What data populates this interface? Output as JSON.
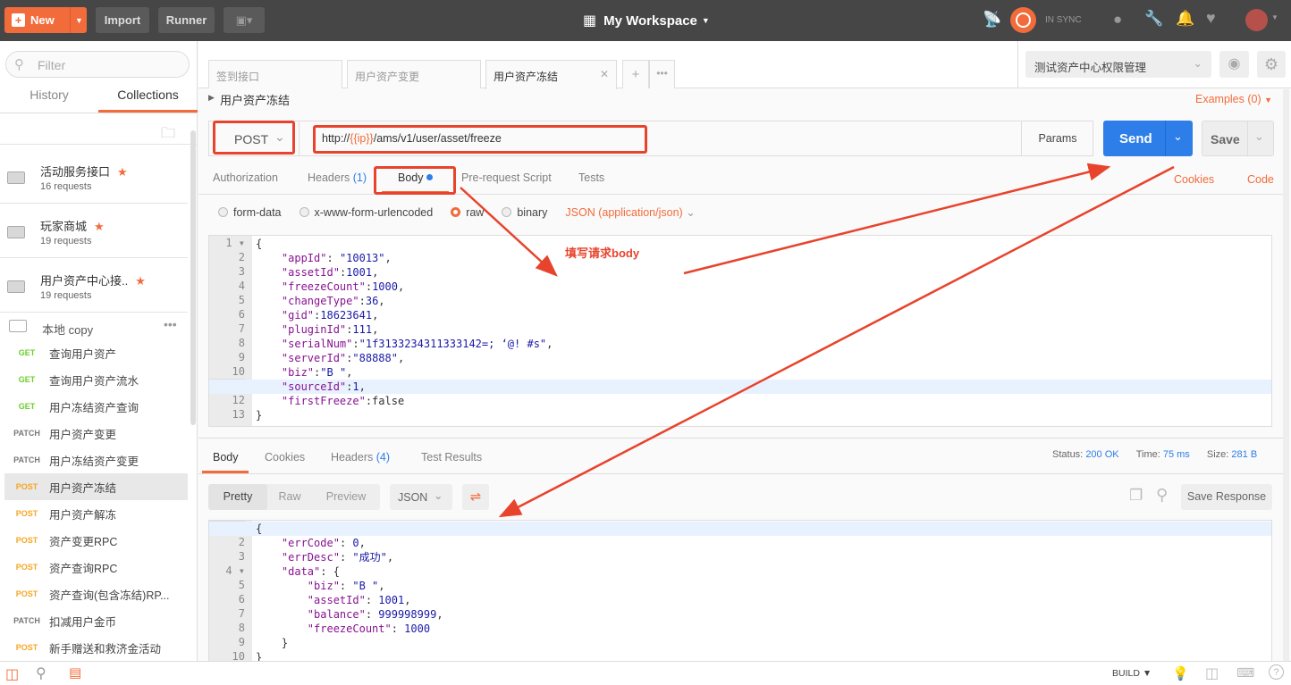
{
  "topbar": {
    "new_label": "New",
    "import_label": "Import",
    "runner_label": "Runner",
    "workspace": "My Workspace",
    "sync_status": "IN SYNC"
  },
  "sidebar": {
    "filter_placeholder": "Filter",
    "tabs": [
      "History",
      "Collections"
    ],
    "active_tab": "Collections",
    "collections": [
      {
        "name": "活动服务接口",
        "count": "16 requests"
      },
      {
        "name": "玩家商城",
        "count": "19 requests"
      },
      {
        "name": "用户资产中心接..",
        "count": "19 requests"
      }
    ],
    "open_collection": "本地 copy",
    "requests": [
      {
        "method": "GET",
        "name": "查询用户资产"
      },
      {
        "method": "GET",
        "name": "查询用户资产流水"
      },
      {
        "method": "GET",
        "name": "用户冻结资产查询"
      },
      {
        "method": "PATCH",
        "name": "用户资产变更"
      },
      {
        "method": "PATCH",
        "name": "用户冻结资产变更"
      },
      {
        "method": "POST",
        "name": "用户资产冻结",
        "selected": true
      },
      {
        "method": "POST",
        "name": "用户资产解冻"
      },
      {
        "method": "POST",
        "name": "资产变更RPC"
      },
      {
        "method": "POST",
        "name": "资产查询RPC"
      },
      {
        "method": "POST",
        "name": "资产查询(包含冻结)RP..."
      },
      {
        "method": "PATCH",
        "name": "扣减用户金币"
      },
      {
        "method": "POST",
        "name": "新手赠送和救济金活动"
      }
    ]
  },
  "request_tabs": [
    "签到接口",
    "用户资产变更",
    "用户资产冻结"
  ],
  "environment": "测试资产中心权限管理",
  "request": {
    "name": "用户资产冻结",
    "examples": "Examples (0)",
    "method": "POST",
    "url_prefix": "http://",
    "url_var": "{{ip}}",
    "url_suffix": "/ams/v1/user/asset/freeze",
    "params": "Params",
    "send": "Send",
    "save": "Save",
    "tabs": {
      "authorization": "Authorization",
      "headers": "Headers",
      "headers_count": "(1)",
      "body": "Body",
      "prerequest": "Pre-request Script",
      "tests": "Tests"
    },
    "cookies": "Cookies",
    "code": "Code",
    "body_modes": [
      "form-data",
      "x-www-form-urlencoded",
      "raw",
      "binary"
    ],
    "selected_mode": "raw",
    "content_type": "JSON (application/json)",
    "body_lines": [
      [
        [
          "p",
          "{"
        ]
      ],
      [
        [
          "p",
          "    "
        ],
        [
          "k",
          "\"appId\""
        ],
        [
          "p",
          ": "
        ],
        [
          "s",
          "\"10013\""
        ],
        [
          "p",
          ","
        ]
      ],
      [
        [
          "p",
          "    "
        ],
        [
          "k",
          "\"assetId\""
        ],
        [
          "p",
          ":"
        ],
        [
          "n",
          "1001"
        ],
        [
          "p",
          ","
        ]
      ],
      [
        [
          "p",
          "    "
        ],
        [
          "k",
          "\"freezeCount\""
        ],
        [
          "p",
          ":"
        ],
        [
          "n",
          "1000"
        ],
        [
          "p",
          ","
        ]
      ],
      [
        [
          "p",
          "    "
        ],
        [
          "k",
          "\"changeType\""
        ],
        [
          "p",
          ":"
        ],
        [
          "n",
          "36"
        ],
        [
          "p",
          ","
        ]
      ],
      [
        [
          "p",
          "    "
        ],
        [
          "k",
          "\"gid\""
        ],
        [
          "p",
          ":"
        ],
        [
          "n",
          "18623641"
        ],
        [
          "p",
          ","
        ]
      ],
      [
        [
          "p",
          "    "
        ],
        [
          "k",
          "\"pluginId\""
        ],
        [
          "p",
          ":"
        ],
        [
          "n",
          "111"
        ],
        [
          "p",
          ","
        ]
      ],
      [
        [
          "p",
          "    "
        ],
        [
          "k",
          "\"serialNum\""
        ],
        [
          "p",
          ":"
        ],
        [
          "s",
          "\"1f3133234311333142=; ‘@! #s\""
        ],
        [
          "p",
          ","
        ]
      ],
      [
        [
          "p",
          "    "
        ],
        [
          "k",
          "\"serverId\""
        ],
        [
          "p",
          ":"
        ],
        [
          "s",
          "\"88888\""
        ],
        [
          "p",
          ","
        ]
      ],
      [
        [
          "p",
          "    "
        ],
        [
          "k",
          "\"biz\""
        ],
        [
          "p",
          ":"
        ],
        [
          "s",
          "\"B \""
        ],
        [
          "p",
          ","
        ]
      ],
      [
        [
          "p",
          "    "
        ],
        [
          "k",
          "\"sourceId\""
        ],
        [
          "p",
          ":"
        ],
        [
          "n",
          "1"
        ],
        [
          "p",
          ","
        ]
      ],
      [
        [
          "p",
          "    "
        ],
        [
          "k",
          "\"firstFreeze\""
        ],
        [
          "p",
          ":false"
        ]
      ],
      [
        [
          "p",
          "}"
        ]
      ]
    ]
  },
  "annotation": "填写请求body",
  "response": {
    "tabs": {
      "body": "Body",
      "cookies": "Cookies",
      "headers": "Headers",
      "headers_count": "(4)",
      "tests": "Test Results"
    },
    "status_label": "Status:",
    "status": "200 OK",
    "time_label": "Time:",
    "time": "75 ms",
    "size_label": "Size:",
    "size": "281 B",
    "view_modes": [
      "Pretty",
      "Raw",
      "Preview"
    ],
    "format": "JSON",
    "save_response": "Save Response",
    "body_lines": [
      [
        [
          "p",
          "{"
        ]
      ],
      [
        [
          "p",
          "    "
        ],
        [
          "k",
          "\"errCode\""
        ],
        [
          "p",
          ": "
        ],
        [
          "n",
          "0"
        ],
        [
          "p",
          ","
        ]
      ],
      [
        [
          "p",
          "    "
        ],
        [
          "k",
          "\"errDesc\""
        ],
        [
          "p",
          ": "
        ],
        [
          "s",
          "\"成功\""
        ],
        [
          "p",
          ","
        ]
      ],
      [
        [
          "p",
          "    "
        ],
        [
          "k",
          "\"data\""
        ],
        [
          "p",
          ": {"
        ]
      ],
      [
        [
          "p",
          "        "
        ],
        [
          "k",
          "\"biz\""
        ],
        [
          "p",
          ": "
        ],
        [
          "s",
          "\"B \""
        ],
        [
          "p",
          ","
        ]
      ],
      [
        [
          "p",
          "        "
        ],
        [
          "k",
          "\"assetId\""
        ],
        [
          "p",
          ": "
        ],
        [
          "n",
          "1001"
        ],
        [
          "p",
          ","
        ]
      ],
      [
        [
          "p",
          "        "
        ],
        [
          "k",
          "\"balance\""
        ],
        [
          "p",
          ": "
        ],
        [
          "n",
          "999998999"
        ],
        [
          "p",
          ","
        ]
      ],
      [
        [
          "p",
          "        "
        ],
        [
          "k",
          "\"freezeCount\""
        ],
        [
          "p",
          ": "
        ],
        [
          "n",
          "1000"
        ]
      ],
      [
        [
          "p",
          "    }"
        ]
      ],
      [
        [
          "p",
          "}"
        ]
      ]
    ]
  },
  "statusbar": {
    "build": "BUILD ▼"
  },
  "colors": {
    "accent": "#f26b3a",
    "send": "#2d7ee8",
    "annotation": "#e8432c"
  }
}
